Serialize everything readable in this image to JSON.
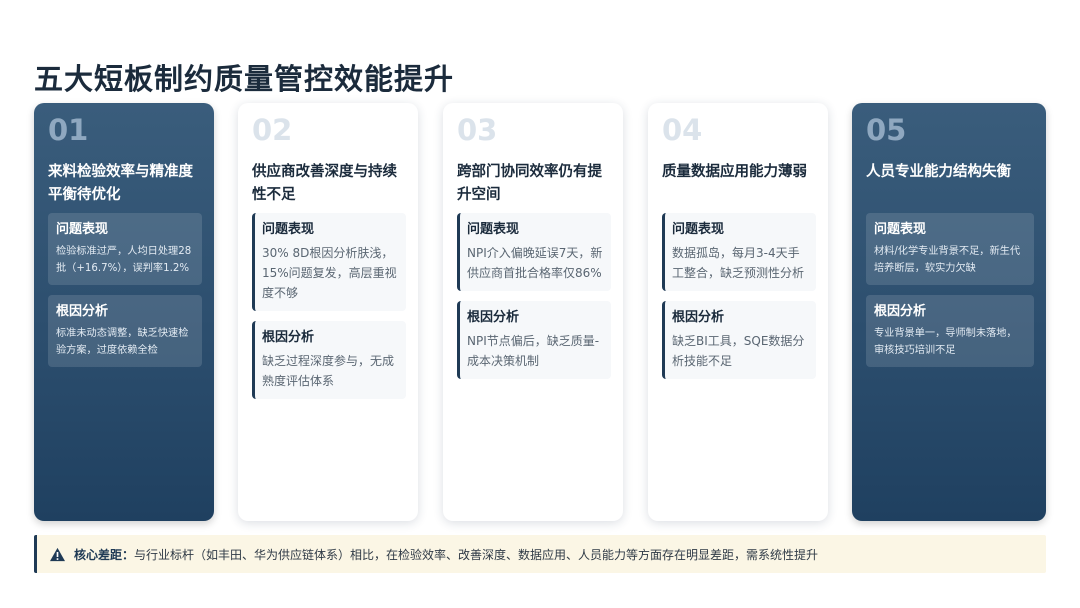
{
  "title": "五大短板制约质量管控效能提升",
  "cards": [
    {
      "num": "01",
      "heading": "来料检验效率与精准度平衡待优化",
      "issue_title": "问题表现",
      "issue_text": "检验标准过严，人均日处理28批（+16.7%），误判率1.2%",
      "cause_title": "根因分析",
      "cause_text": "标准未动态调整，缺乏快速检验方案，过度依赖全检"
    },
    {
      "num": "02",
      "heading": "供应商改善深度与持续性不足",
      "issue_title": "问题表现",
      "issue_text": "30% 8D根因分析肤浅，15%问题复发，高层重视度不够",
      "cause_title": "根因分析",
      "cause_text": "缺乏过程深度参与，无成熟度评估体系"
    },
    {
      "num": "03",
      "heading": "跨部门协同效率仍有提升空间",
      "issue_title": "问题表现",
      "issue_text": "NPI介入偏晚延误7天，新供应商首批合格率仅86%",
      "cause_title": "根因分析",
      "cause_text": "NPI节点偏后，缺乏质量-成本决策机制"
    },
    {
      "num": "04",
      "heading": "质量数据应用能力薄弱",
      "issue_title": "问题表现",
      "issue_text": "数据孤岛，每月3-4天手工整合，缺乏预测性分析",
      "cause_title": "根因分析",
      "cause_text": "缺乏BI工具，SQE数据分析技能不足"
    },
    {
      "num": "05",
      "heading": "人员专业能力结构失衡",
      "issue_title": "问题表现",
      "issue_text": "材料/化学专业背景不足，新生代培养断层，软实力欠缺",
      "cause_title": "根因分析",
      "cause_text": "专业背景单一，导师制未落地，审核技巧培训不足"
    }
  ],
  "note": {
    "icon": "warning-icon",
    "label": "核心差距：",
    "text": "与行业标杆（如丰田、华为供应链体系）相比，在检验效率、改善深度、数据应用、人员能力等方面存在明显差距，需系统性提升"
  }
}
